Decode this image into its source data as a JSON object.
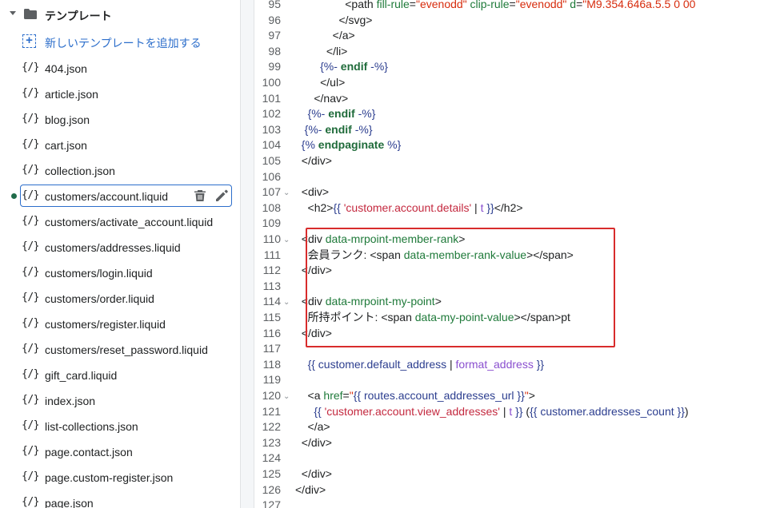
{
  "sidebar": {
    "folder_label": "テンプレート",
    "add_label": "新しいテンプレートを追加する",
    "file_icon_glyph": "{/}",
    "files": [
      {
        "label": "404.json"
      },
      {
        "label": "article.json"
      },
      {
        "label": "blog.json"
      },
      {
        "label": "cart.json"
      },
      {
        "label": "collection.json"
      },
      {
        "label": "customers/account.liquid",
        "selected": true,
        "modified": true
      },
      {
        "label": "customers/activate_account.liquid"
      },
      {
        "label": "customers/addresses.liquid"
      },
      {
        "label": "customers/login.liquid"
      },
      {
        "label": "customers/order.liquid"
      },
      {
        "label": "customers/register.liquid"
      },
      {
        "label": "customers/reset_password.liquid"
      },
      {
        "label": "gift_card.liquid"
      },
      {
        "label": "index.json"
      },
      {
        "label": "list-collections.json"
      },
      {
        "label": "page.contact.json"
      },
      {
        "label": "page.custom-register.json"
      },
      {
        "label": "page.json"
      }
    ]
  },
  "editor": {
    "lines": [
      {
        "n": "95",
        "fold": false,
        "tokens": [
          {
            "t": "                <path ",
            "c": "tag"
          },
          {
            "t": "fill-rule",
            "c": "attr"
          },
          {
            "t": "=",
            "c": "tag"
          },
          {
            "t": "\"evenodd\"",
            "c": "str"
          },
          {
            "t": " ",
            "c": "tag"
          },
          {
            "t": "clip-rule",
            "c": "attr"
          },
          {
            "t": "=",
            "c": "tag"
          },
          {
            "t": "\"evenodd\"",
            "c": "str"
          },
          {
            "t": " ",
            "c": "tag"
          },
          {
            "t": "d",
            "c": "attr"
          },
          {
            "t": "=",
            "c": "tag"
          },
          {
            "t": "\"M9.354.646a.5.5 0 00",
            "c": "str"
          }
        ]
      },
      {
        "n": "96",
        "fold": false,
        "tokens": [
          {
            "t": "              </svg>",
            "c": "tag"
          }
        ]
      },
      {
        "n": "97",
        "fold": false,
        "tokens": [
          {
            "t": "            </a>",
            "c": "tag"
          }
        ]
      },
      {
        "n": "98",
        "fold": false,
        "tokens": [
          {
            "t": "          </li>",
            "c": "tag"
          }
        ]
      },
      {
        "n": "99",
        "fold": false,
        "tokens": [
          {
            "t": "        ",
            "c": "tag"
          },
          {
            "t": "{%-",
            "c": "liq"
          },
          {
            "t": " endif ",
            "c": "kw"
          },
          {
            "t": "-%}",
            "c": "liq"
          }
        ]
      },
      {
        "n": "100",
        "fold": false,
        "tokens": [
          {
            "t": "        </ul>",
            "c": "tag"
          }
        ]
      },
      {
        "n": "101",
        "fold": false,
        "tokens": [
          {
            "t": "      </nav>",
            "c": "tag"
          }
        ]
      },
      {
        "n": "102",
        "fold": false,
        "tokens": [
          {
            "t": "    ",
            "c": "tag"
          },
          {
            "t": "{%-",
            "c": "liq"
          },
          {
            "t": " endif ",
            "c": "kw"
          },
          {
            "t": "-%}",
            "c": "liq"
          }
        ]
      },
      {
        "n": "103",
        "fold": false,
        "tokens": [
          {
            "t": "   ",
            "c": "tag"
          },
          {
            "t": "{%-",
            "c": "liq"
          },
          {
            "t": " endif ",
            "c": "kw"
          },
          {
            "t": "-%}",
            "c": "liq"
          }
        ]
      },
      {
        "n": "104",
        "fold": false,
        "tokens": [
          {
            "t": "  ",
            "c": "tag"
          },
          {
            "t": "{%",
            "c": "liq"
          },
          {
            "t": " endpaginate ",
            "c": "kw"
          },
          {
            "t": "%}",
            "c": "liq"
          }
        ]
      },
      {
        "n": "105",
        "fold": false,
        "tokens": [
          {
            "t": "  </div>",
            "c": "tag"
          }
        ]
      },
      {
        "n": "106",
        "fold": false,
        "tokens": []
      },
      {
        "n": "107",
        "fold": true,
        "tokens": [
          {
            "t": "  <div>",
            "c": "tag"
          }
        ]
      },
      {
        "n": "108",
        "fold": false,
        "tokens": [
          {
            "t": "    <h2>",
            "c": "tag"
          },
          {
            "t": "{{ ",
            "c": "liq"
          },
          {
            "t": "'customer.account.details'",
            "c": "strl"
          },
          {
            "t": " | ",
            "c": "tag"
          },
          {
            "t": "t",
            "c": "filter"
          },
          {
            "t": " }}",
            "c": "liq"
          },
          {
            "t": "</h2>",
            "c": "tag"
          }
        ]
      },
      {
        "n": "109",
        "fold": false,
        "tokens": []
      },
      {
        "n": "110",
        "fold": true,
        "tokens": [
          {
            "t": "  <div ",
            "c": "tag"
          },
          {
            "t": "data-mrpoint-member-rank",
            "c": "attr"
          },
          {
            "t": ">",
            "c": "tag"
          }
        ]
      },
      {
        "n": "111",
        "fold": false,
        "tokens": [
          {
            "t": "    会員ランク: <span ",
            "c": "tag"
          },
          {
            "t": "data-member-rank-value",
            "c": "attr"
          },
          {
            "t": "></span>",
            "c": "tag"
          }
        ]
      },
      {
        "n": "112",
        "fold": false,
        "tokens": [
          {
            "t": "  </div>",
            "c": "tag"
          }
        ]
      },
      {
        "n": "113",
        "fold": false,
        "tokens": []
      },
      {
        "n": "114",
        "fold": true,
        "tokens": [
          {
            "t": "  <div ",
            "c": "tag"
          },
          {
            "t": "data-mrpoint-my-point",
            "c": "attr"
          },
          {
            "t": ">",
            "c": "tag"
          }
        ]
      },
      {
        "n": "115",
        "fold": false,
        "tokens": [
          {
            "t": "    所持ポイント: <span ",
            "c": "tag"
          },
          {
            "t": "data-my-point-value",
            "c": "attr"
          },
          {
            "t": "></span>pt",
            "c": "tag"
          }
        ]
      },
      {
        "n": "116",
        "fold": false,
        "tokens": [
          {
            "t": "  </div>",
            "c": "tag"
          }
        ]
      },
      {
        "n": "117",
        "fold": false,
        "tokens": []
      },
      {
        "n": "118",
        "fold": false,
        "tokens": [
          {
            "t": "    ",
            "c": "tag"
          },
          {
            "t": "{{ customer.default_address",
            "c": "liq"
          },
          {
            "t": " | ",
            "c": "tag"
          },
          {
            "t": "format_address",
            "c": "filter"
          },
          {
            "t": " }}",
            "c": "liq"
          }
        ]
      },
      {
        "n": "119",
        "fold": false,
        "tokens": []
      },
      {
        "n": "120",
        "fold": true,
        "tokens": [
          {
            "t": "    <a ",
            "c": "tag"
          },
          {
            "t": "href",
            "c": "attr"
          },
          {
            "t": "=",
            "c": "tag"
          },
          {
            "t": "\"",
            "c": "str"
          },
          {
            "t": "{{ routes.account_addresses_url }}",
            "c": "liq"
          },
          {
            "t": "\"",
            "c": "str"
          },
          {
            "t": ">",
            "c": "tag"
          }
        ]
      },
      {
        "n": "121",
        "fold": false,
        "tokens": [
          {
            "t": "      ",
            "c": "tag"
          },
          {
            "t": "{{ ",
            "c": "liq"
          },
          {
            "t": "'customer.account.view_addresses'",
            "c": "strl"
          },
          {
            "t": " | ",
            "c": "tag"
          },
          {
            "t": "t",
            "c": "filter"
          },
          {
            "t": " }}",
            "c": "liq"
          },
          {
            "t": " (",
            "c": "tag"
          },
          {
            "t": "{{ customer.addresses_count }}",
            "c": "liq"
          },
          {
            "t": ")",
            "c": "tag"
          }
        ]
      },
      {
        "n": "122",
        "fold": false,
        "tokens": [
          {
            "t": "    </a>",
            "c": "tag"
          }
        ]
      },
      {
        "n": "123",
        "fold": false,
        "tokens": [
          {
            "t": "  </div>",
            "c": "tag"
          }
        ]
      },
      {
        "n": "124",
        "fold": false,
        "tokens": []
      },
      {
        "n": "125",
        "fold": false,
        "tokens": [
          {
            "t": "  </div>",
            "c": "tag"
          }
        ]
      },
      {
        "n": "126",
        "fold": false,
        "tokens": [
          {
            "t": "</div>",
            "c": "tag"
          }
        ]
      },
      {
        "n": "127",
        "fold": false,
        "tokens": []
      }
    ]
  }
}
